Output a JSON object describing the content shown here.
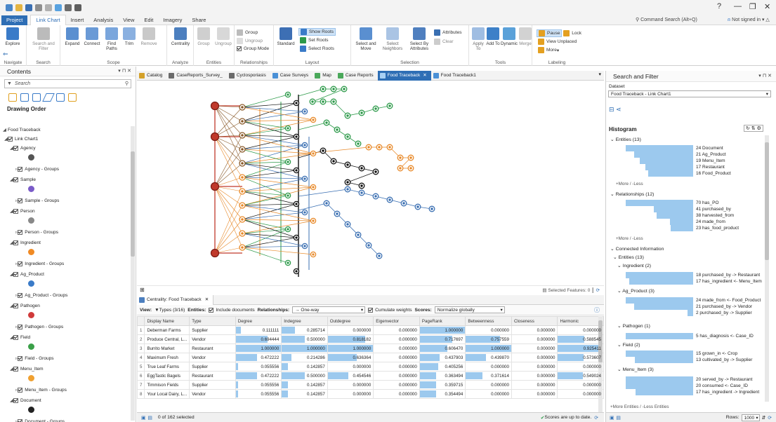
{
  "titlebar": {
    "help": "?",
    "minimize": "—",
    "restore": "❐",
    "close": "✕"
  },
  "tabs": [
    "Project",
    "Link Chart",
    "Insert",
    "Analysis",
    "View",
    "Edit",
    "Imagery",
    "Share"
  ],
  "command_search": "Command Search (Alt+Q)",
  "signin": "Not signed in",
  "ribbon": {
    "navigate": {
      "explore": "Explore",
      "label": "Navigate"
    },
    "search": {
      "search_filter": "Search and Filter",
      "label": "Search"
    },
    "scope": {
      "expand": "Expand",
      "connect": "Connect",
      "find_paths": "Find Paths",
      "trim": "Trim",
      "remove": "Remove",
      "label": "Scope"
    },
    "analyze": {
      "centrality": "Centrality",
      "label": "Analyze"
    },
    "entities": {
      "group": "Group",
      "ungroup": "Ungroup",
      "label": "Entities"
    },
    "relationships": {
      "group": "Group",
      "ungroup": "Ungroup",
      "group_mode": "Group Mode",
      "label": "Relationships"
    },
    "layout": {
      "standard": "Standard",
      "show_roots": "Show Roots",
      "set_roots": "Set Roots",
      "select_roots": "Select Roots",
      "label": "Layout"
    },
    "selection": {
      "select_move": "Select and Move",
      "select_neighbors": "Select Neighbors",
      "select_by_attributes": "Select By Attributes",
      "attributes": "Attributes",
      "clear": "Clear",
      "label": "Selection"
    },
    "tools": {
      "apply_to": "Apply To",
      "add_to": "Add To",
      "dynamic": "Dynamic",
      "merge": "Merge",
      "label": "Tools"
    },
    "labeling": {
      "pause": "Pause",
      "lock": "Lock",
      "view_unplaced": "View Unplaced",
      "more": "More",
      "label": "Labeling"
    }
  },
  "contents": {
    "title": "Contents",
    "search_placeholder": "Search",
    "drawing_order": "Drawing Order",
    "root": "Food Traceback",
    "chart": "Link Chart1",
    "items": [
      {
        "label": "Agency",
        "group": "Agency - Groups",
        "color": "#555555"
      },
      {
        "label": "Sample",
        "group": "Sample - Groups",
        "color": "#7a5bc8"
      },
      {
        "label": "Person",
        "group": "Person - Groups",
        "color": "#888888"
      },
      {
        "label": "Ingredient",
        "group": "Ingredient - Groups",
        "color": "#f08a24"
      },
      {
        "label": "Ag_Product",
        "group": "Ag_Product - Groups",
        "color": "#3a7bc8"
      },
      {
        "label": "Pathogen",
        "group": "Pathogen - Groups",
        "color": "#d03a3a"
      },
      {
        "label": "Field",
        "group": "Field - Groups",
        "color": "#3aa048"
      },
      {
        "label": "Menu_Item",
        "group": "Menu_Item - Groups",
        "color": "#f0a030"
      },
      {
        "label": "Document",
        "group": "Document - Groups",
        "color": "#222222"
      }
    ]
  },
  "map_tabs": [
    "Catalog",
    "CaseReports_Survey_",
    "Cyclosporiasis",
    "Case Surveys",
    "Map",
    "Case Reports",
    "Food Traceback",
    "Food Traceback1"
  ],
  "canvas": {
    "selected_features": "Selected Features: 0"
  },
  "centrality": {
    "tab": "Centrality: Food Traceback",
    "view_label": "View:",
    "types": "Types (3/16)",
    "entities_label": "Entities:",
    "include_documents": "Include documents",
    "relationships_label": "Relationships:",
    "one_way": "One-way",
    "cumulate": "Cumulate weights",
    "scores_label": "Scores:",
    "normalize": "Normalize globally",
    "columns": [
      "Display Name",
      "Type",
      "Degree",
      "Indegree",
      "Outdegree",
      "Eigenvector",
      "PageRank",
      "Betweenness",
      "Closeness",
      "Harmonic"
    ],
    "rows": [
      [
        "Deberman Farms",
        "Supplier",
        0.111111,
        0.285714,
        0.0,
        0.0,
        1.0,
        0.0,
        0.0,
        0.0
      ],
      [
        "Produce Central, L...",
        "Vendor",
        0.694444,
        0.5,
        0.818182,
        0.0,
        0.717697,
        0.757559,
        0.0,
        0.588545
      ],
      [
        "Burrito Market",
        "Restaurant",
        1.0,
        1.0,
        1.0,
        0.0,
        0.60647,
        1.0,
        0.0,
        0.925411
      ],
      [
        "Maximum Fresh",
        "Vendor",
        0.472222,
        0.214286,
        0.636364,
        0.0,
        0.437903,
        0.43987,
        0.0,
        0.573607
      ],
      [
        "True Leaf Farms",
        "Supplier",
        0.055556,
        0.142857,
        0.0,
        0.0,
        0.405256,
        0.0,
        0.0,
        0.0
      ],
      [
        "EggTastic Bagels",
        "Restaurant",
        0.472222,
        0.5,
        0.454546,
        0.0,
        0.363494,
        0.371614,
        0.0,
        0.549024
      ],
      [
        "Timmison Fields",
        "Supplier",
        0.055556,
        0.142857,
        0.0,
        0.0,
        0.359715,
        0.0,
        0.0,
        0.0
      ],
      [
        "Your Local Dairy, L...",
        "Vendor",
        0.055556,
        0.142857,
        0.0,
        0.0,
        0.354494,
        0.0,
        0.0,
        0.0
      ]
    ],
    "selection": "0 of 162 selected",
    "status": "Scores are up to date."
  },
  "search_filter": {
    "title": "Search and Filter",
    "dataset_label": "Dataset",
    "dataset": "Food Traceback - Link Chart1",
    "histogram": "Histogram",
    "entities": "Entities (13)",
    "entity_rows": [
      {
        "count": 24,
        "label": "Document"
      },
      {
        "count": 21,
        "label": "Ag_Product"
      },
      {
        "count": 19,
        "label": "Menu_Item"
      },
      {
        "count": 17,
        "label": "Restaurant"
      },
      {
        "count": 16,
        "label": "Food_Product"
      }
    ],
    "more_less": "+More / -Less",
    "relationships": "Relationships (12)",
    "rel_rows": [
      {
        "count": 70,
        "label": "has_PO"
      },
      {
        "count": 41,
        "label": "purchased_by"
      },
      {
        "count": 38,
        "label": "harvested_from"
      },
      {
        "count": 24,
        "label": "made_from"
      },
      {
        "count": 23,
        "label": "has_food_product"
      }
    ],
    "connected": "Connected Information",
    "conn_entities": "Entities (13)",
    "ingredient": "Ingredient (2)",
    "ingredient_rows": [
      {
        "count": 18,
        "label": "purchased_by -> Restaurant"
      },
      {
        "count": 17,
        "label": "has_ingredient <- Menu_Item"
      }
    ],
    "ag_product": "Ag_Product (3)",
    "ag_rows": [
      {
        "count": 24,
        "label": "made_from <- Food_Product"
      },
      {
        "count": 21,
        "label": "purchased_by -> Vendor"
      },
      {
        "count": 2,
        "label": "purchased_by -> Supplier"
      }
    ],
    "pathogen": "Pathogen (1)",
    "pathogen_rows": [
      {
        "count": 5,
        "label": "has_diagnosis <- Case_ID"
      }
    ],
    "field": "Field (2)",
    "field_rows": [
      {
        "count": 15,
        "label": "grown_in <- Crop"
      },
      {
        "count": 13,
        "label": "cultivated_by -> Supplier"
      }
    ],
    "menu_item": "Menu_Item (3)",
    "menu_rows": [
      {
        "count": 20,
        "label": "served_by -> Restaurant"
      },
      {
        "count": 20,
        "label": "consumed <- Case_ID"
      },
      {
        "count": 17,
        "label": "has_ingredient -> Ingredient"
      }
    ],
    "more_entities": "+More Entities / -Less Entities",
    "rows_label": "Rows:",
    "rows_value": "1000"
  },
  "colors": {
    "accent": "#2e6eb5",
    "bar": "#9cc9ee"
  }
}
